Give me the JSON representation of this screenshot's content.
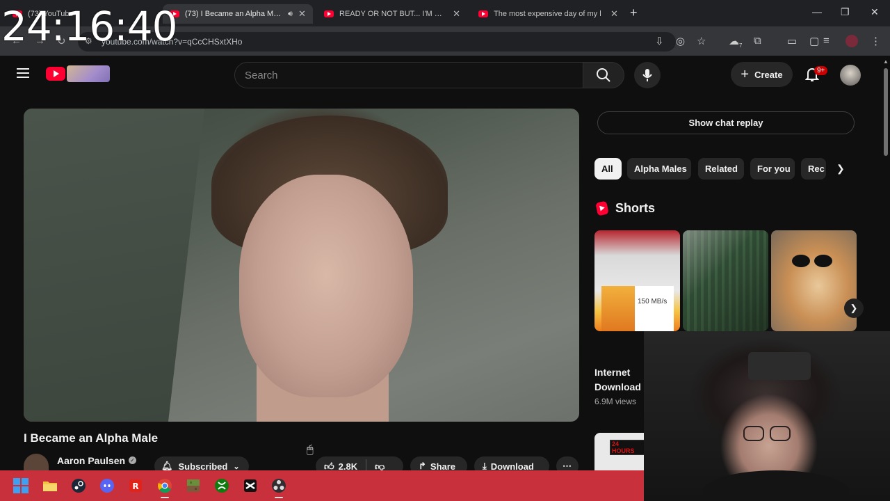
{
  "overlay": {
    "clock": "24:16:40"
  },
  "browser": {
    "tabs": [
      {
        "title": "(73) YouTube",
        "active": false
      },
      {
        "title": "(73) I Became an Alpha Male",
        "active": true
      },
      {
        "title": "READY OR NOT BUT... I'M NOT",
        "active": false
      },
      {
        "title": "The most expensive day of my l",
        "active": false
      }
    ],
    "url": "youtube.com/watch?v=qCcCHSxtXHo",
    "extension_badge": "7"
  },
  "header": {
    "search_placeholder": "Search",
    "create_label": "Create",
    "notification_count": "9+"
  },
  "video": {
    "title": "I Became an Alpha Male",
    "channel": "Aaron Paulsen",
    "subscribe_label": "Subscribed",
    "likes": "2.8K",
    "share_label": "Share",
    "download_label": "Download"
  },
  "sidebar": {
    "chat_replay_label": "Show chat replay",
    "chips": [
      "All",
      "Alpha Males",
      "Related",
      "For you",
      "Rec"
    ],
    "shorts_title": "Shorts",
    "shorts": [
      {
        "overlay_text": "150 MB/s"
      },
      {
        "overlay_text": ""
      },
      {
        "overlay_text": ""
      }
    ],
    "short_caption": "Internet Download",
    "short_views": "6.9M views",
    "next_thumb_text": "24 HOURS"
  },
  "colors": {
    "background": "#0f0f0f",
    "youtube_red": "#ff0033",
    "taskbar": "#c8303c",
    "chip_active": "#f1f1f1"
  },
  "taskbar": {
    "icons": [
      "windows-start-icon",
      "file-explorer-icon",
      "steam-icon",
      "discord-icon",
      "roblox-icon",
      "chrome-icon",
      "minecraft-icon",
      "xbox-icon",
      "capcut-icon",
      "obs-icon"
    ]
  }
}
